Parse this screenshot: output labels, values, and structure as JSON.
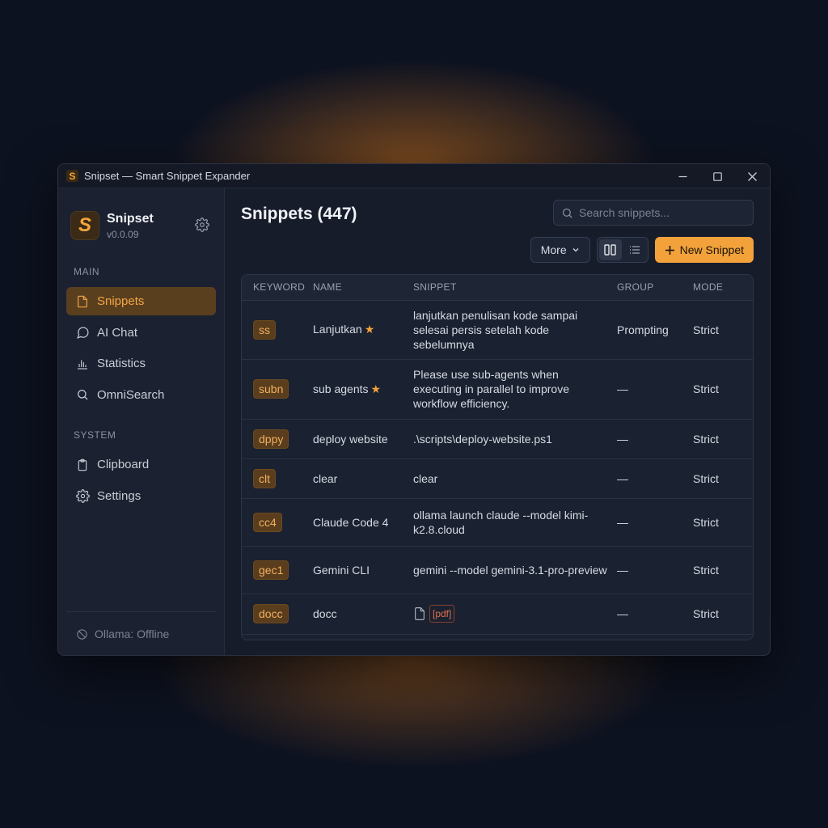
{
  "window": {
    "title": "Snipset — Smart Snippet Expander"
  },
  "brand": {
    "logo_letter": "S",
    "name": "Snipset",
    "version": "v0.0.09"
  },
  "sidebar": {
    "main_label": "MAIN",
    "main_items": [
      {
        "label": "Snippets",
        "icon": "file-icon",
        "active": true
      },
      {
        "label": "AI Chat",
        "icon": "chat-bubble-icon"
      },
      {
        "label": "Statistics",
        "icon": "bar-chart-icon"
      },
      {
        "label": "OmniSearch",
        "icon": "search-icon"
      }
    ],
    "system_label": "SYSTEM",
    "system_items": [
      {
        "label": "Clipboard",
        "icon": "clipboard-icon"
      },
      {
        "label": "Settings",
        "icon": "gear-icon"
      }
    ],
    "footer_status": "Ollama: Offline"
  },
  "main": {
    "title": "Snippets (447)",
    "search_placeholder": "Search snippets...",
    "more_label": "More",
    "new_label": "New Snippet"
  },
  "table": {
    "headers": [
      "KEYWORD",
      "NAME",
      "SNIPPET",
      "GROUP",
      "MODE"
    ],
    "rows": [
      {
        "keyword": "ss",
        "name": "Lanjutkan",
        "starred": true,
        "snippet": "lanjutkan penulisan kode sampai selesai persis setelah kode sebelumnya",
        "group": "Prompting",
        "mode": "Strict"
      },
      {
        "keyword": "subn",
        "name": "sub agents",
        "starred": true,
        "snippet": "Please use sub-agents when executing in parallel to improve workflow efficiency.",
        "group": "—",
        "mode": "Strict"
      },
      {
        "keyword": "dppy",
        "name": "deploy website",
        "starred": false,
        "snippet": ".\\scripts\\deploy-website.ps1",
        "group": "—",
        "mode": "Strict"
      },
      {
        "keyword": "clt",
        "name": "clear",
        "starred": false,
        "snippet": "clear",
        "group": "—",
        "mode": "Strict"
      },
      {
        "keyword": "cc4",
        "name": "Claude Code 4",
        "starred": false,
        "snippet": "ollama launch claude --model kimi-k2.8.cloud",
        "group": "—",
        "mode": "Strict"
      },
      {
        "keyword": "gec1",
        "name": "Gemini CLI",
        "starred": false,
        "snippet": "gemini --model gemini-3.1-pro-preview",
        "group": "—",
        "mode": "Strict"
      },
      {
        "keyword": "docc",
        "name": "docc",
        "starred": false,
        "snippet": "",
        "attachment": "[pdf]",
        "group": "—",
        "mode": "Strict"
      }
    ]
  },
  "colors": {
    "accent": "#f3a23b",
    "background": "#0d1220",
    "panel": "#161c2a"
  }
}
